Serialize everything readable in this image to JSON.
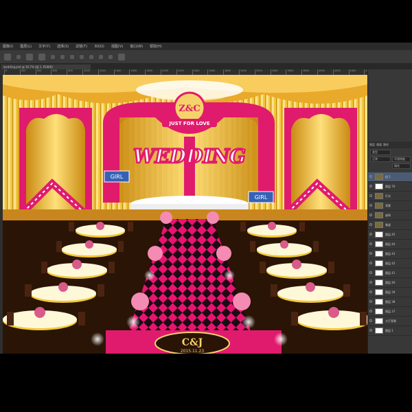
{
  "menu": {
    "items": [
      "图像(I)",
      "图层(L)",
      "文字(Y)",
      "选择(S)",
      "滤镜(T)",
      "3D(D)",
      "视图(V)",
      "窗口(W)",
      "帮助(H)"
    ]
  },
  "document_tab": {
    "label": "wedding.psd @ 16.7% (组 1, RGB/8)"
  },
  "ruler": {
    "labels": [
      "0",
      "200",
      "400",
      "600",
      "800",
      "1000",
      "1200",
      "1400",
      "1600",
      "1800",
      "2000",
      "2200",
      "2400",
      "2600",
      "2800",
      "3000",
      "3200",
      "3400",
      "3600",
      "3800",
      "4000",
      "4200",
      "4400",
      "4600"
    ]
  },
  "artwork": {
    "monogram_top": "Z&C",
    "banner_text": "JUST FOR LOVE",
    "main_title": "WEDDING",
    "license_plate": "GIRL",
    "floor_logo": "C&J",
    "floor_date": "2015.11.23"
  },
  "layers_panel": {
    "tabs": [
      "图层",
      "通道",
      "路径"
    ],
    "kind_filter": "类型",
    "blend_mode": "正常",
    "opacity_label": "不透明度",
    "fill_label": "填充",
    "layers": [
      {
        "name": "组 1",
        "kind": "folder",
        "selected": true
      },
      {
        "name": "图层 70",
        "kind": "layer"
      },
      {
        "name": "灯光",
        "kind": "folder"
      },
      {
        "name": "背景",
        "kind": "folder"
      },
      {
        "name": "座椅",
        "kind": "folder"
      },
      {
        "name": "餐桌",
        "kind": "folder"
      },
      {
        "name": "图层 45",
        "kind": "layer"
      },
      {
        "name": "图层 44",
        "kind": "layer"
      },
      {
        "name": "图层 43",
        "kind": "layer"
      },
      {
        "name": "图层 42",
        "kind": "layer"
      },
      {
        "name": "图层 41",
        "kind": "layer"
      },
      {
        "name": "图层 40",
        "kind": "layer"
      },
      {
        "name": "图层 39",
        "kind": "layer"
      },
      {
        "name": "图层 38",
        "kind": "layer"
      },
      {
        "name": "图层 37",
        "kind": "layer"
      },
      {
        "name": "大厅背景",
        "kind": "layer"
      },
      {
        "name": "图层 1",
        "kind": "layer"
      }
    ]
  },
  "colors": {
    "gold": "#f1c23a",
    "magenta": "#e0186d",
    "carpet_dark": "#1a0b12",
    "ps_panel": "#383838",
    "selection": "#4b5b72"
  }
}
